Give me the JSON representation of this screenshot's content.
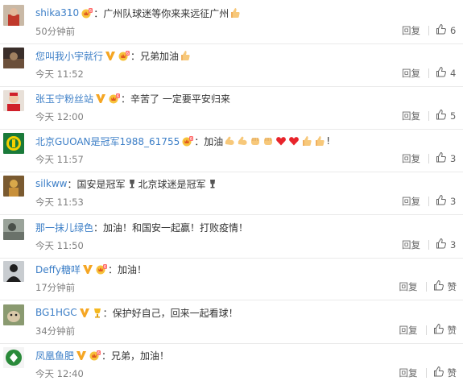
{
  "comments": [
    {
      "user": "shika310",
      "badges": [
        "vip-crown-icon"
      ],
      "sep": "：",
      "text": "广州队球迷等你来来远征广州",
      "emoji_after": [
        "thumbs-up-emoji"
      ],
      "time": "50分钟前",
      "reply": "回复",
      "likes": "6",
      "avatar": "avatar-red-shirt"
    },
    {
      "user": "您叫我小宇就行",
      "badges": [
        "verified-v-icon",
        "vip-crown-icon"
      ],
      "sep": "：",
      "text": "兄弟加油",
      "emoji_after": [
        "thumbs-up-emoji"
      ],
      "time": "今天 11:52",
      "reply": "回复",
      "likes": "4",
      "avatar": "avatar-dark-photo"
    },
    {
      "user": "张玉宁粉丝站",
      "badges": [
        "verified-v-icon",
        "vip-crown-icon"
      ],
      "sep": "：",
      "text": "辛苦了 一定要平安归来",
      "emoji_after": [],
      "time": "今天 12:00",
      "reply": "回复",
      "likes": "5",
      "avatar": "avatar-person-red"
    },
    {
      "user": "北京GUOAN是冠军1988_61755",
      "badges": [
        "vip-crown-icon"
      ],
      "sep": "：",
      "text": "加油",
      "emoji_after": [
        "muscle-emoji",
        "muscle-emoji",
        "fist-emoji",
        "fist-emoji",
        "heart-emoji",
        "heart-emoji",
        "thumbs-up-emoji",
        "thumbs-up-emoji"
      ],
      "text_end": "!",
      "time": "今天 11:57",
      "reply": "回复",
      "likes": "3",
      "avatar": "avatar-guoan-logo"
    },
    {
      "user": "silkww",
      "badges": [],
      "sep": "：",
      "text": "国安是冠军",
      "emoji_after": [
        "trophy-emoji"
      ],
      "text2": "北京球迷是冠军",
      "emoji_after2": [
        "trophy-emoji"
      ],
      "time": "今天 11:53",
      "reply": "回复",
      "likes": "3",
      "avatar": "avatar-golden-statue"
    },
    {
      "user": "那一抹儿绿色",
      "badges": [],
      "sep": "：",
      "text": "加油！和国安一起赢！打败疫情！",
      "emoji_after": [],
      "time": "今天 11:50",
      "reply": "回复",
      "likes": "3",
      "avatar": "avatar-grey-scene"
    },
    {
      "user": "Deffy糖咩",
      "badges": [
        "verified-v-icon",
        "vip-crown-icon"
      ],
      "sep": "：",
      "text": "加油！",
      "emoji_after": [],
      "time": "17分钟前",
      "reply": "回复",
      "likes": "赞",
      "avatar": "avatar-silhouette"
    },
    {
      "user": "BG1HGC",
      "badges": [
        "verified-v-icon",
        "trophy-badge-icon"
      ],
      "sep": "：",
      "text": "保护好自己，回来一起看球！",
      "emoji_after": [],
      "time": "34分钟前",
      "reply": "回复",
      "likes": "赞",
      "avatar": "avatar-dog"
    },
    {
      "user": "凤凰鱼肥",
      "badges": [
        "verified-v-icon",
        "vip-crown-icon"
      ],
      "sep": "：",
      "text": "兄弟，加油！",
      "emoji_after": [],
      "time": "今天 12:40",
      "reply": "回复",
      "likes": "赞",
      "avatar": "avatar-green-logo"
    }
  ],
  "colors": {
    "username": "#3d7fc7",
    "username_first": "#3d7fc7",
    "verified": "#f5a623",
    "text": "#333333",
    "time": "#808080"
  }
}
